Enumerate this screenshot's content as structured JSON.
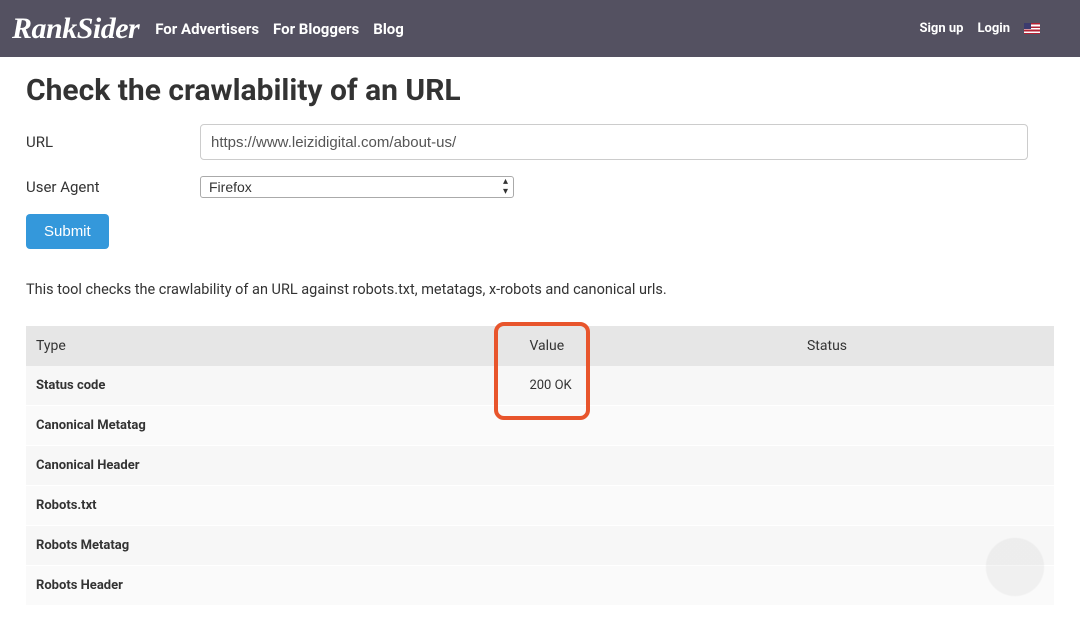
{
  "brand": "RankSider",
  "nav": {
    "advertisers": "For Advertisers",
    "bloggers": "For Bloggers",
    "blog": "Blog",
    "signup": "Sign up",
    "login": "Login"
  },
  "page": {
    "title": "Check the crawlability of an URL",
    "url_label": "URL",
    "url_value": "https://www.leizidigital.com/about-us/",
    "ua_label": "User Agent",
    "ua_value": "Firefox",
    "submit_label": "Submit",
    "description": "This tool checks the crawlability of an URL against robots.txt, metatags, x-robots and canonical urls."
  },
  "table": {
    "headers": {
      "type": "Type",
      "value": "Value",
      "status": "Status"
    },
    "rows": [
      {
        "type": "Status code",
        "value": "200 OK",
        "status": ""
      },
      {
        "type": "Canonical Metatag",
        "value": "",
        "status": ""
      },
      {
        "type": "Canonical Header",
        "value": "",
        "status": ""
      },
      {
        "type": "Robots.txt",
        "value": "",
        "status": ""
      },
      {
        "type": "Robots Metatag",
        "value": "",
        "status": ""
      },
      {
        "type": "Robots Header",
        "value": "",
        "status": ""
      }
    ]
  }
}
